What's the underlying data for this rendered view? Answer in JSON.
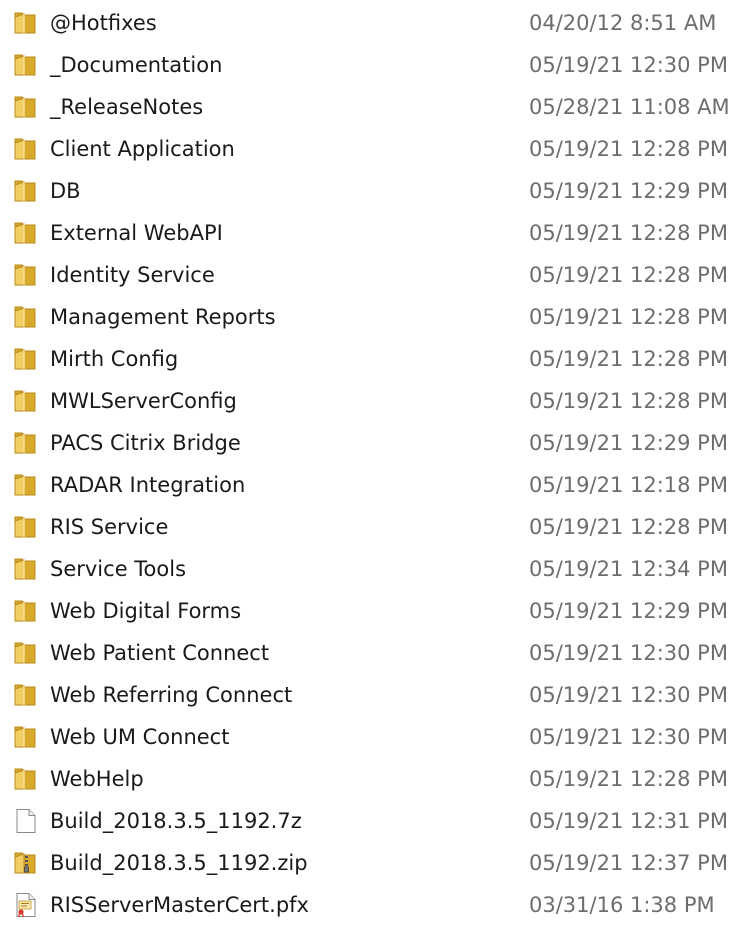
{
  "files": [
    {
      "name": "@Hotfixes",
      "date": "04/20/12 8:51 AM",
      "icon": "folder-icon"
    },
    {
      "name": "_Documentation",
      "date": "05/19/21 12:30 PM",
      "icon": "folder-icon"
    },
    {
      "name": "_ReleaseNotes",
      "date": "05/28/21 11:08 AM",
      "icon": "folder-icon"
    },
    {
      "name": "Client Application",
      "date": "05/19/21 12:28 PM",
      "icon": "folder-icon"
    },
    {
      "name": "DB",
      "date": "05/19/21 12:29 PM",
      "icon": "folder-icon"
    },
    {
      "name": "External WebAPI",
      "date": "05/19/21 12:28 PM",
      "icon": "folder-icon"
    },
    {
      "name": "Identity Service",
      "date": "05/19/21 12:28 PM",
      "icon": "folder-icon"
    },
    {
      "name": "Management Reports",
      "date": "05/19/21 12:28 PM",
      "icon": "folder-icon"
    },
    {
      "name": "Mirth Config",
      "date": "05/19/21 12:28 PM",
      "icon": "folder-icon"
    },
    {
      "name": "MWLServerConfig",
      "date": "05/19/21 12:28 PM",
      "icon": "folder-icon"
    },
    {
      "name": "PACS Citrix Bridge",
      "date": "05/19/21 12:29 PM",
      "icon": "folder-icon"
    },
    {
      "name": "RADAR Integration",
      "date": "05/19/21 12:18 PM",
      "icon": "folder-icon"
    },
    {
      "name": "RIS Service",
      "date": "05/19/21 12:28 PM",
      "icon": "folder-icon"
    },
    {
      "name": "Service Tools",
      "date": "05/19/21 12:34 PM",
      "icon": "folder-icon"
    },
    {
      "name": "Web Digital Forms",
      "date": "05/19/21 12:29 PM",
      "icon": "folder-icon"
    },
    {
      "name": "Web Patient Connect",
      "date": "05/19/21 12:30 PM",
      "icon": "folder-icon"
    },
    {
      "name": "Web Referring Connect",
      "date": "05/19/21 12:30 PM",
      "icon": "folder-icon"
    },
    {
      "name": "Web UM Connect",
      "date": "05/19/21 12:30 PM",
      "icon": "folder-icon"
    },
    {
      "name": "WebHelp",
      "date": "05/19/21 12:28 PM",
      "icon": "folder-icon"
    },
    {
      "name": "Build_2018.3.5_1192.7z",
      "date": "05/19/21 12:31 PM",
      "icon": "blank-file-icon"
    },
    {
      "name": "Build_2018.3.5_1192.zip",
      "date": "05/19/21 12:37 PM",
      "icon": "zip-folder-icon"
    },
    {
      "name": "RISServerMasterCert.pfx",
      "date": "03/31/16 1:38 PM",
      "icon": "certificate-icon"
    }
  ],
  "colors": {
    "folder_back": "#d9a92c",
    "folder_front": "#f2cf63",
    "folder_edge": "#b88a1b",
    "name_text": "#1a1a1a",
    "date_text": "#6d6d6d"
  }
}
